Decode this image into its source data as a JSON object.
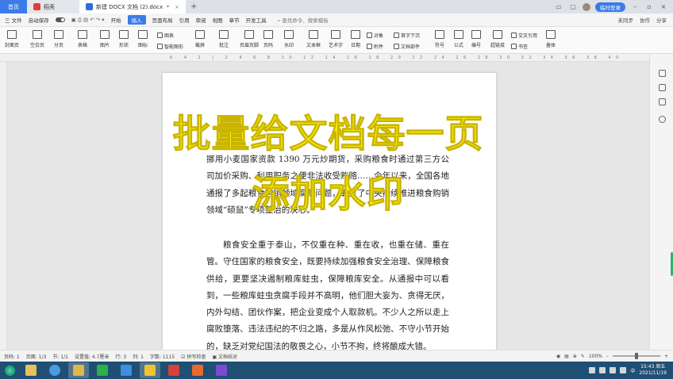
{
  "tabs": {
    "home": "首页",
    "daoke": "稻壳",
    "doc": "新建 DOCX 文档 (2).docx",
    "login": "临时登录"
  },
  "menu": {
    "file": "三 文件",
    "autosave": "自动保存",
    "items": [
      "开始",
      "插入",
      "页面布局",
      "引用",
      "审阅",
      "视图",
      "章节",
      "开发工具"
    ],
    "search": "查找命令、搜索模板",
    "cloud": "未同步",
    "collab": "协作",
    "share": "分享"
  },
  "ribbon": {
    "big": [
      "封面页",
      "空白页",
      "分页",
      "表格",
      "图片",
      "形状",
      "图标",
      "截屏",
      "批注",
      "页眉页脚",
      "页码",
      "水印",
      "文本框",
      "艺术字",
      "日期",
      "附件",
      "文档部件",
      "符号",
      "公式",
      "编号",
      "超链接",
      "书签",
      "交叉引用",
      "叠体"
    ],
    "small": [
      "图表",
      "智能图形",
      "对象",
      "首字下沉"
    ]
  },
  "ruler_numbers": "6 4 2 | 2 4 6 8 10 12 14 16 18 20 22 24 26 28 30 32 34 36 38 40",
  "document": {
    "para1": "挪用小麦国家资款 1390 万元炒期货，采购粮食时通过第三方公司加价采购、利用职务之便非法收受贿赂……今年以来，全国各地通报了多起粮食购销领域腐败问题，彰显了中央持续推进粮食购销领域“硕鼠”专项整治的决心。",
    "para2": "粮食安全重于泰山，不仅重在种、重在收，也重在储、重在管。守住国家的粮食安全，既要持续加强粮食安全治理、保障粮食供给，更要坚决遏制粮库蛀虫，保障粮库安全。从通报中可以看到，一些粮库蛀虫贪腐手段并不高明，他们胆大妄为、贪得无厌，内外勾结、团伙作案，把企业变成个人取款机。不少人之所以走上腐败堕落、违法违纪的不归之路，多是从作风松弛、不守小节开始的，缺乏对党纪国法的敬畏之心，小节不拘，终将酿成大错。"
  },
  "overlay": {
    "line1": "批量给文档每一页",
    "line2": "添加水印"
  },
  "status": {
    "page": "页码: 1",
    "pages": "页面: 1/3",
    "section": "节: 1/1",
    "settings": "设置值: 4.7厘米",
    "row": "行: 3",
    "col": "列: 1",
    "words": "字数: 1115",
    "spell": "拼写检查",
    "proof": "文档校对",
    "zoom": "100%"
  },
  "taskbar": {
    "time": "15:43 周五",
    "date": "2021/11/19",
    "ime": "中"
  },
  "colors": {
    "accent": "#3b7be8",
    "overlay_text": "#fff200",
    "taskbar": "#1f4f73"
  }
}
